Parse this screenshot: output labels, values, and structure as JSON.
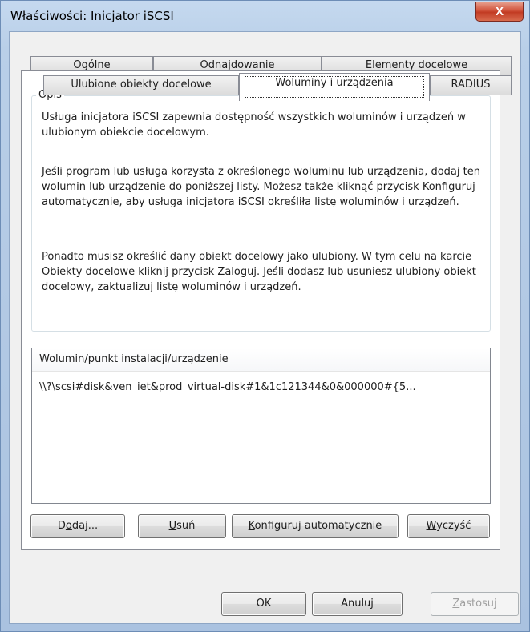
{
  "window": {
    "title": "Właściwości: Inicjator iSCSI",
    "close_glyph": "X"
  },
  "tabs": {
    "row1": [
      "Ogólne",
      "Odnajdowanie",
      "Elementy docelowe"
    ],
    "row2": [
      "Ulubione obiekty docelowe",
      "Woluminy i urządzenia",
      "RADIUS"
    ],
    "active": "Woluminy i urządzenia"
  },
  "description": {
    "legend": "Opis",
    "p1": "Usługa inicjatora iSCSI zapewnia dostępność wszystkich woluminów i urządzeń w ulubionym obiekcie docelowym.",
    "p2": "Jeśli program lub usługa korzysta z określonego woluminu lub urządzenia, dodaj ten wolumin lub urządzenie do poniższej listy. Możesz także kliknąć przycisk Konfiguruj automatycznie, aby usługa inicjatora iSCSI określiła listę woluminów i urządzeń.",
    "p3": "Ponadto musisz określić dany obiekt docelowy jako ulubiony. W tym celu na karcie Obiekty docelowe kliknij przycisk Zaloguj. Jeśli dodasz lub usuniesz ulubiony obiekt docelowy, zaktualizuj listę woluminów i urządzeń."
  },
  "volume_list": {
    "column_header": "Wolumin/punkt instalacji/urządzenie",
    "rows": [
      "\\\\?\\scsi#disk&ven_iet&prod_virtual-disk#1&1c121344&0&000000#{5..."
    ]
  },
  "list_buttons": {
    "add": {
      "pre": "D",
      "key": "o",
      "post": "daj..."
    },
    "remove": {
      "pre": "",
      "key": "U",
      "post": "suń"
    },
    "autoconfig": {
      "pre": "",
      "key": "K",
      "post": "onfiguruj automatycznie"
    },
    "clear": {
      "pre": "",
      "key": "W",
      "post": "yczyść"
    }
  },
  "dialog_buttons": {
    "ok": "OK",
    "cancel": "Anuluj",
    "apply": {
      "pre": "",
      "key": "Z",
      "post": "astosuj",
      "enabled": false
    }
  },
  "colors": {
    "frame": "#b9cfe8",
    "close_button": "#c94a30",
    "client_bg": "#f0f0f0"
  }
}
